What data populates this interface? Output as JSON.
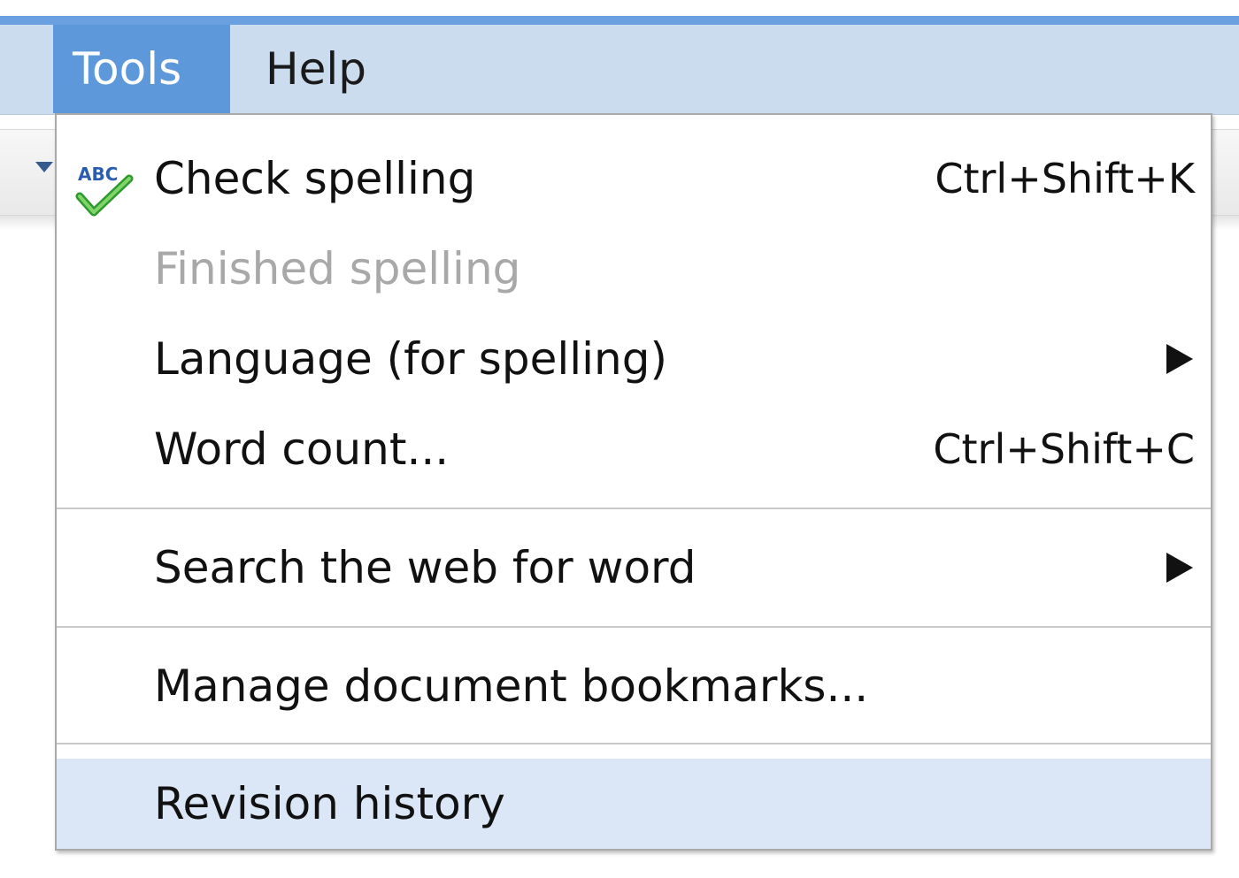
{
  "menubar": {
    "tools_label": "Tools",
    "help_label": "Help"
  },
  "tools_menu": {
    "items": [
      {
        "label": "Check spelling",
        "shortcut": "Ctrl+Shift+K",
        "icon": "spell-check-icon",
        "enabled": true
      },
      {
        "label": "Finished spelling",
        "enabled": false
      },
      {
        "label": "Language (for spelling)",
        "submenu": true,
        "enabled": true
      },
      {
        "label": "Word count...",
        "shortcut": "Ctrl+Shift+C",
        "enabled": true
      },
      {
        "label": "Search the web for word",
        "submenu": true,
        "enabled": true
      },
      {
        "label": "Manage document bookmarks...",
        "enabled": true
      },
      {
        "label": "Revision history",
        "enabled": true,
        "highlighted": true
      }
    ]
  },
  "colors": {
    "menubar_bg": "#cbdcee",
    "active_menu_bg": "#5d98da",
    "highlight_bg": "#dbe7f6",
    "disabled_text": "#a8a8a8"
  }
}
